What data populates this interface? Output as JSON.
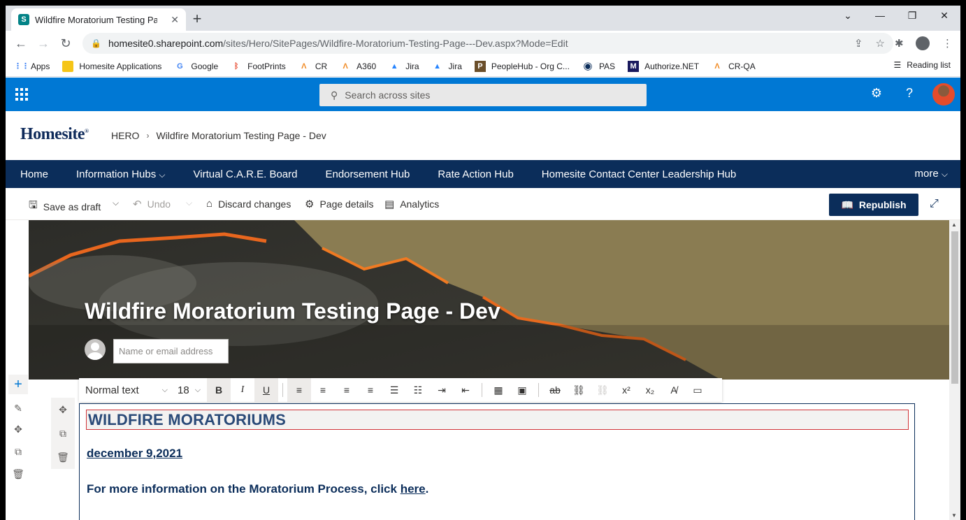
{
  "browser": {
    "tab_title": "Wildfire Moratorium Testing Page",
    "url_host": "homesite0.sharepoint.com",
    "url_path": "/sites/Hero/SitePages/Wildfire-Moratorium-Testing-Page---Dev.aspx?Mode=Edit",
    "bookmarks": [
      {
        "label": "Apps",
        "icon": "apps-grid-icon",
        "color": "#4285f4"
      },
      {
        "label": "Homesite Applications",
        "icon": "folder-icon",
        "color": "#f5c518"
      },
      {
        "label": "Google",
        "icon": "google-icon",
        "color": "#4285f4"
      },
      {
        "label": "FootPrints",
        "icon": "footprints-icon",
        "color": "#e8543b"
      },
      {
        "label": "CR",
        "icon": "cr-icon",
        "color": "#f08a24"
      },
      {
        "label": "A360",
        "icon": "a360-icon",
        "color": "#f08a24"
      },
      {
        "label": "Jira",
        "icon": "jira-icon",
        "color": "#2684ff"
      },
      {
        "label": "Jira",
        "icon": "jira-icon",
        "color": "#2684ff"
      },
      {
        "label": "PeopleHub - Org C...",
        "icon": "peoplehub-icon",
        "color": "#6b4f2a"
      },
      {
        "label": "PAS",
        "icon": "pas-icon",
        "color": "#0b2d5a"
      },
      {
        "label": "Authorize.NET",
        "icon": "authorize-net-icon",
        "color": "#1a1a5e"
      },
      {
        "label": "CR-QA",
        "icon": "cr-qa-icon",
        "color": "#f08a24"
      }
    ],
    "reading_list": "Reading list"
  },
  "suite": {
    "search_placeholder": "Search across sites"
  },
  "site": {
    "logo": "Homesite",
    "breadcrumb_root": "HERO",
    "breadcrumb_page": "Wildfire Moratorium Testing Page - Dev"
  },
  "hubnav": {
    "items": [
      "Home",
      "Information Hubs",
      "Virtual C.A.R.E. Board",
      "Endorsement Hub",
      "Rate Action Hub",
      "Homesite Contact Center Leadership Hub"
    ],
    "more": "more"
  },
  "commands": {
    "save_draft": "Save as draft",
    "undo": "Undo",
    "discard": "Discard changes",
    "page_details": "Page details",
    "analytics": "Analytics",
    "republish": "Republish"
  },
  "page": {
    "title": "Wildfire Moratorium Testing Page - Dev",
    "author_placeholder": "Name or email address"
  },
  "rte": {
    "style": "Normal text",
    "size": "18"
  },
  "content": {
    "heading": "WILDFIRE MORATORIUMS",
    "date": "december 9,2021",
    "info_text": "For more information on the Moratorium Process, click ",
    "info_link": "here",
    "info_end": "."
  }
}
